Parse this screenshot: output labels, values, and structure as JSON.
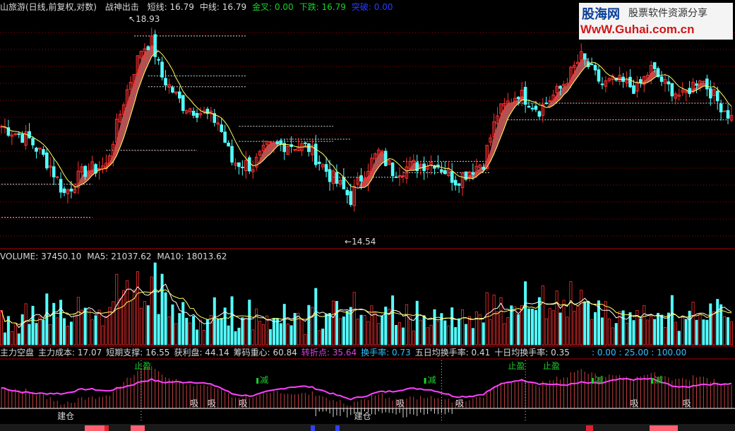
{
  "header": {
    "stock": "山旅游(日线,前复权,对数)",
    "indicator": "战神出击",
    "items": [
      {
        "label": "短线:",
        "value": "16.79",
        "color": "#d8d8d8"
      },
      {
        "label": "中线:",
        "value": "16.79",
        "color": "#d8d8d8"
      },
      {
        "label": "金叉:",
        "value": "0.00",
        "color": "#19d22a"
      },
      {
        "label": "下跌:",
        "value": "16.79",
        "color": "#19d22a"
      },
      {
        "label": "突破:",
        "value": "0.00",
        "color": "#2a3cff"
      }
    ]
  },
  "watermark": {
    "cn": "股海网",
    "cn2": "股票软件资源分享",
    "url": "WwW.Guhai.com.cn"
  },
  "volume_header": {
    "label": "VOLUME:",
    "value": "37450.10",
    "ma5_label": "MA5:",
    "ma5": "21037.62",
    "ma10_label": "MA10:",
    "ma10": "18013.62"
  },
  "indicator_header": {
    "items": [
      {
        "text": "主力空盘",
        "color": "#d8d8d8"
      },
      {
        "text": "主力成本: 17.07",
        "color": "#d8d8d8"
      },
      {
        "text": "短期支撑: 16.55",
        "color": "#d8d8d8"
      },
      {
        "text": "获利盘: 44.14",
        "color": "#d8d8d8"
      },
      {
        "text": "筹码重心: 60.84",
        "color": "#d8d8d8"
      },
      {
        "text": "转折点: 35.64",
        "color": "#e040e0"
      },
      {
        "text": "换手率: 0.73",
        "color": "#30c0ff"
      },
      {
        "text": "五日均换手率: 0.41",
        "color": "#d8d8d8"
      },
      {
        "text": "十日均换手率: 0.35",
        "color": "#d8d8d8"
      }
    ],
    "scale": ": 0.00  : 25.00  : 100.00"
  },
  "chart_data": {
    "type": "candlestick",
    "price_high_label": "18.93",
    "price_low_label": "14.54",
    "price_range": [
      14.0,
      19.4
    ],
    "support_levels": [
      {
        "from": 0,
        "to": 26,
        "y": 14.6
      },
      {
        "from": 0,
        "to": 26,
        "y": 15.3
      },
      {
        "from": 38,
        "to": 70,
        "y": 18.85
      },
      {
        "from": 42,
        "to": 70,
        "y": 17.55
      },
      {
        "from": 42,
        "to": 70,
        "y": 17.82
      },
      {
        "from": 30,
        "to": 56,
        "y": 16.05
      },
      {
        "from": 68,
        "to": 95,
        "y": 16.6
      },
      {
        "from": 68,
        "to": 95,
        "y": 16.25
      },
      {
        "from": 80,
        "to": 100,
        "y": 16.3
      },
      {
        "from": 95,
        "to": 115,
        "y": 15.45
      },
      {
        "from": 115,
        "to": 140,
        "y": 15.8
      },
      {
        "from": 115,
        "to": 140,
        "y": 15.55
      },
      {
        "from": 145,
        "to": 208,
        "y": 17.15
      },
      {
        "from": 145,
        "to": 208,
        "y": 16.75
      }
    ],
    "volume_label_series": [
      "VOLUME",
      "MA5",
      "MA10"
    ],
    "indicator_labels": [
      {
        "text": "止盈",
        "i": 38,
        "color": "#19d22a",
        "pos": "top"
      },
      {
        "text": "止盈",
        "i": 145,
        "color": "#19d22a",
        "pos": "top"
      },
      {
        "text": "止盈",
        "i": 155,
        "color": "#19d22a",
        "pos": "top"
      },
      {
        "text": "减",
        "i": 74,
        "color": "#19d22a",
        "pos": "mid"
      },
      {
        "text": "减",
        "i": 122,
        "color": "#19d22a",
        "pos": "mid"
      },
      {
        "text": "减",
        "i": 170,
        "color": "#19d22a",
        "pos": "mid"
      },
      {
        "text": "减",
        "i": 187,
        "color": "#19d22a",
        "pos": "mid"
      },
      {
        "text": "吸",
        "i": 54,
        "color": "#d8d8d8",
        "pos": "low"
      },
      {
        "text": "吸",
        "i": 59,
        "color": "#d8d8d8",
        "pos": "low"
      },
      {
        "text": "吸",
        "i": 68,
        "color": "#d8d8d8",
        "pos": "low"
      },
      {
        "text": "吸",
        "i": 113,
        "color": "#d8d8d8",
        "pos": "low"
      },
      {
        "text": "吸",
        "i": 130,
        "color": "#d8d8d8",
        "pos": "low"
      },
      {
        "text": "吸",
        "i": 180,
        "color": "#d8d8d8",
        "pos": "low"
      },
      {
        "text": "吸",
        "i": 195,
        "color": "#d8d8d8",
        "pos": "low"
      },
      {
        "text": "建仓",
        "i": 16,
        "color": "#d8d8d8",
        "pos": "bottom"
      },
      {
        "text": "建仓",
        "i": 101,
        "color": "#d8d8d8",
        "pos": "bottom"
      }
    ],
    "colors": {
      "up": "#ff3030",
      "down": "#54ffff",
      "ma": "#ffff60",
      "ribbon": "#d06060",
      "pink": "#ff40ff",
      "grid": "#b00000"
    }
  }
}
